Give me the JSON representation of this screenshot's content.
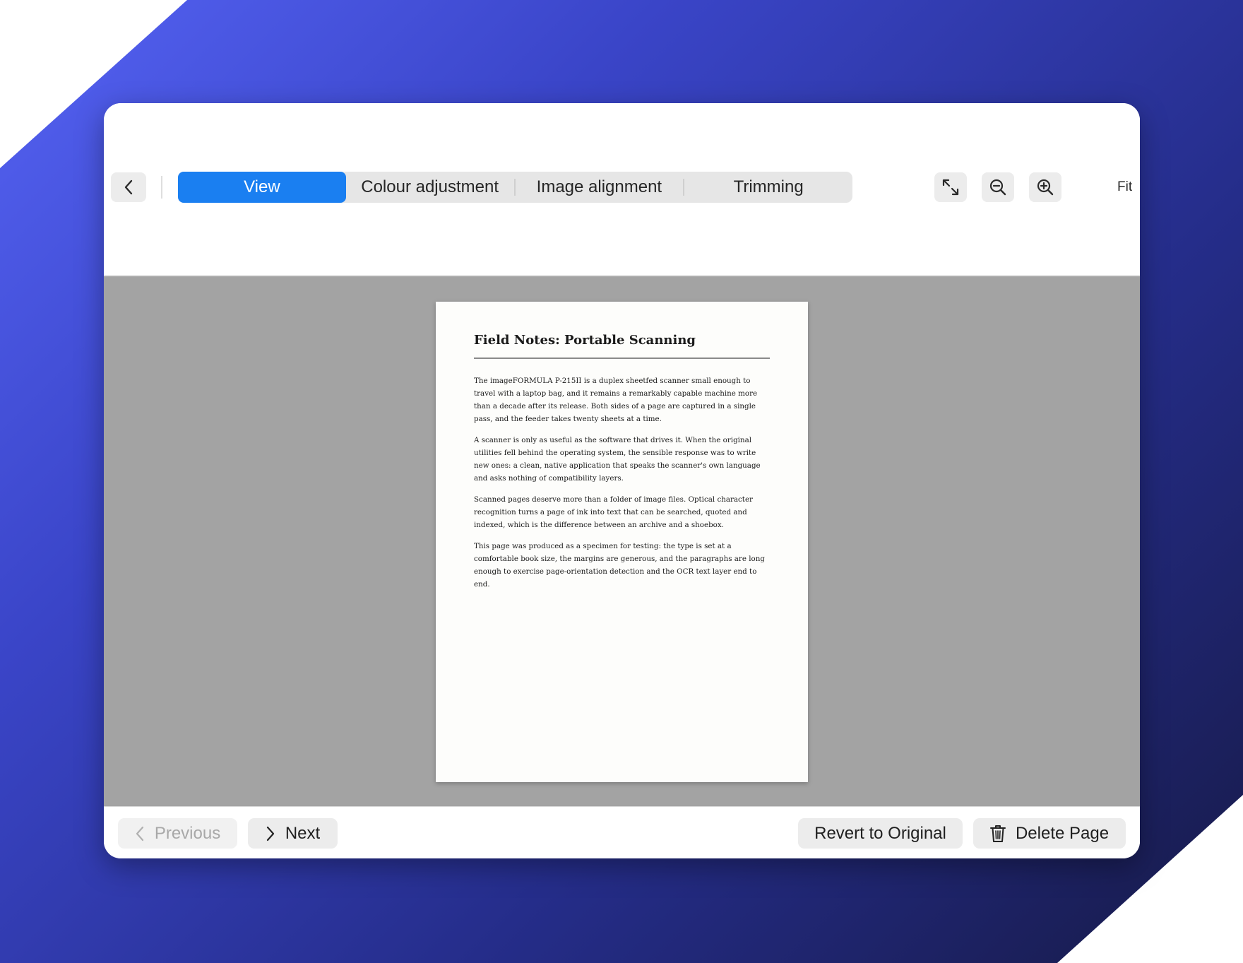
{
  "toolbar": {
    "tabs": [
      {
        "label": "View",
        "active": true
      },
      {
        "label": "Colour adjustment",
        "active": false
      },
      {
        "label": "Image alignment",
        "active": false
      },
      {
        "label": "Trimming",
        "active": false
      }
    ],
    "fit_label": "Fit",
    "icons": {
      "back": "chevron-left-icon",
      "fullscreen": "expand-arrows-icon",
      "zoom_out": "zoom-out-icon",
      "zoom_in": "zoom-in-icon"
    },
    "accent_color": "#1a7ff1"
  },
  "document": {
    "title": "Field Notes: Portable Scanning",
    "paragraphs": [
      "The imageFORMULA P-215II is a duplex sheetfed scanner small enough to travel with a laptop bag, and it remains a remarkably capable machine more than a decade after its release. Both sides of a page are captured in a single pass, and the feeder takes twenty sheets at a time.",
      "A scanner is only as useful as the software that drives it. When the original utilities fell behind the operating system, the sensible response was to write new ones: a clean, native application that speaks the scanner's own language and asks nothing of compatibility layers.",
      "Scanned pages deserve more than a folder of image files. Optical character recognition turns a page of ink into text that can be searched, quoted and indexed, which is the difference between an archive and a shoebox.",
      "This page was produced as a specimen for testing: the type is set at a comfortable book size, the margins are generous, and the paragraphs are long enough to exercise page-orientation detection and the OCR text layer end to end."
    ]
  },
  "footer": {
    "previous_label": "Previous",
    "previous_enabled": false,
    "next_label": "Next",
    "revert_label": "Revert to Original",
    "delete_label": "Delete Page",
    "icons": {
      "previous": "chevron-left-icon",
      "next": "chevron-right-icon",
      "delete": "trash-icon"
    }
  }
}
